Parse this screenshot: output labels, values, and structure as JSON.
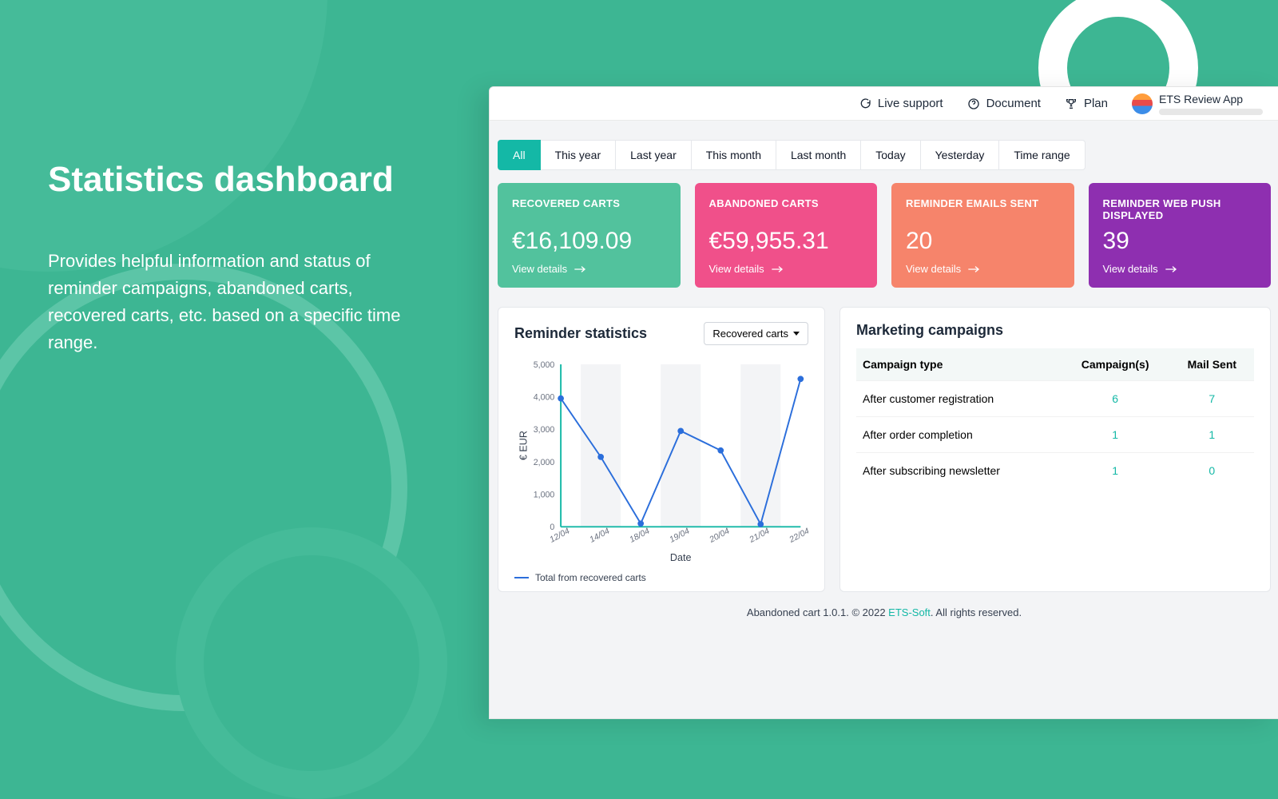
{
  "promo": {
    "title": "Statistics dashboard",
    "body": "Provides helpful information and status of reminder campaigns, abandoned carts, recovered carts, etc. based on a specific time range."
  },
  "topbar": {
    "live": "Live support",
    "doc": "Document",
    "plan": "Plan",
    "user": "ETS Review App"
  },
  "filters": [
    "All",
    "This year",
    "Last year",
    "This month",
    "Last month",
    "Today",
    "Yesterday",
    "Time range"
  ],
  "filter_active": 0,
  "cards": [
    {
      "caption": "RECOVERED CARTS",
      "value": "€16,109.09",
      "link": "View details"
    },
    {
      "caption": "ABANDONED CARTS",
      "value": "€59,955.31",
      "link": "View details"
    },
    {
      "caption": "REMINDER EMAILS SENT",
      "value": "20",
      "link": "View details"
    },
    {
      "caption": "REMINDER WEB PUSH DISPLAYED",
      "value": "39",
      "link": "View details"
    }
  ],
  "reminder_panel": {
    "title": "Reminder statistics",
    "select": "Recovered carts",
    "legend": "Total from recovered carts"
  },
  "marketing_panel": {
    "title": "Marketing campaigns",
    "headers": [
      "Campaign type",
      "Campaign(s)",
      "Mail Sent"
    ],
    "rows": [
      {
        "type": "After customer registration",
        "campaigns": "6",
        "mail": "7"
      },
      {
        "type": "After order completion",
        "campaigns": "1",
        "mail": "1"
      },
      {
        "type": "After subscribing newsletter",
        "campaigns": "1",
        "mail": "0"
      }
    ]
  },
  "footer": {
    "pre": "Abandoned cart 1.0.1. © 2022 ",
    "link": "ETS-Soft",
    "post": ". All rights reserved."
  },
  "chart_data": {
    "type": "line",
    "title": "Reminder statistics",
    "xlabel": "Date",
    "ylabel": "€ EUR",
    "ylim": [
      0,
      5000
    ],
    "yticks": [
      0,
      1000,
      2000,
      3000,
      4000,
      5000
    ],
    "categories": [
      "12/04",
      "14/04",
      "18/04",
      "19/04",
      "20/04",
      "21/04",
      "22/04"
    ],
    "series": [
      {
        "name": "Total from recovered carts",
        "values": [
          3950,
          2150,
          100,
          2950,
          2350,
          80,
          4550
        ]
      }
    ]
  }
}
